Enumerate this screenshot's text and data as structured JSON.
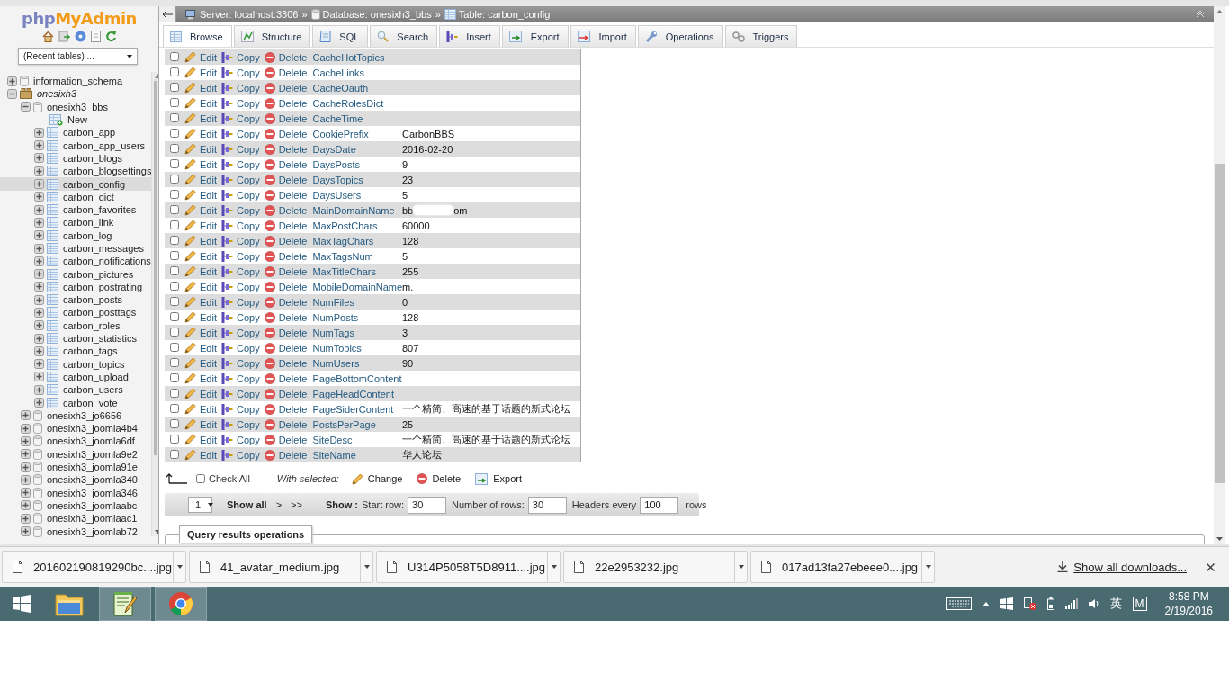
{
  "sidebar": {
    "logo_php": "php",
    "logo_name": "MyAdmin",
    "recent_tables": "(Recent tables) ...",
    "tree": [
      {
        "label": "information_schema",
        "kind": "database",
        "expanded": false
      },
      {
        "label": "onesixh3",
        "kind": "group",
        "expanded": true,
        "children": [
          {
            "label": "onesixh3_bbs",
            "kind": "database",
            "expanded": true,
            "children": [
              {
                "label": "New",
                "kind": "new"
              },
              {
                "label": "carbon_app",
                "kind": "table",
                "expanded": false,
                "selected": false
              },
              {
                "label": "carbon_app_users",
                "kind": "table",
                "expanded": false,
                "selected": false
              },
              {
                "label": "carbon_blogs",
                "kind": "table",
                "expanded": false,
                "selected": false
              },
              {
                "label": "carbon_blogsettings",
                "kind": "table",
                "expanded": false,
                "selected": false
              },
              {
                "label": "carbon_config",
                "kind": "table",
                "expanded": false,
                "selected": true
              },
              {
                "label": "carbon_dict",
                "kind": "table",
                "expanded": false,
                "selected": false
              },
              {
                "label": "carbon_favorites",
                "kind": "table",
                "expanded": false,
                "selected": false
              },
              {
                "label": "carbon_link",
                "kind": "table",
                "expanded": false,
                "selected": false
              },
              {
                "label": "carbon_log",
                "kind": "table",
                "expanded": false,
                "selected": false
              },
              {
                "label": "carbon_messages",
                "kind": "table",
                "expanded": false,
                "selected": false
              },
              {
                "label": "carbon_notifications",
                "kind": "table",
                "expanded": false,
                "selected": false
              },
              {
                "label": "carbon_pictures",
                "kind": "table",
                "expanded": false,
                "selected": false
              },
              {
                "label": "carbon_postrating",
                "kind": "table",
                "expanded": false,
                "selected": false
              },
              {
                "label": "carbon_posts",
                "kind": "table",
                "expanded": false,
                "selected": false
              },
              {
                "label": "carbon_posttags",
                "kind": "table",
                "expanded": false,
                "selected": false
              },
              {
                "label": "carbon_roles",
                "kind": "table",
                "expanded": false,
                "selected": false
              },
              {
                "label": "carbon_statistics",
                "kind": "table",
                "expanded": false,
                "selected": false
              },
              {
                "label": "carbon_tags",
                "kind": "table",
                "expanded": false,
                "selected": false
              },
              {
                "label": "carbon_topics",
                "kind": "table",
                "expanded": false,
                "selected": false
              },
              {
                "label": "carbon_upload",
                "kind": "table",
                "expanded": false,
                "selected": false
              },
              {
                "label": "carbon_users",
                "kind": "table",
                "expanded": false,
                "selected": false
              },
              {
                "label": "carbon_vote",
                "kind": "table",
                "expanded": false,
                "selected": false
              }
            ]
          },
          {
            "label": "onesixh3_jo6656",
            "kind": "database",
            "expanded": false
          },
          {
            "label": "onesixh3_joomla4b4",
            "kind": "database",
            "expanded": false
          },
          {
            "label": "onesixh3_joomla6df",
            "kind": "database",
            "expanded": false
          },
          {
            "label": "onesixh3_joomla9e2",
            "kind": "database",
            "expanded": false
          },
          {
            "label": "onesixh3_joomla91e",
            "kind": "database",
            "expanded": false
          },
          {
            "label": "onesixh3_joomla340",
            "kind": "database",
            "expanded": false
          },
          {
            "label": "onesixh3_joomla346",
            "kind": "database",
            "expanded": false
          },
          {
            "label": "onesixh3_joomlaabc",
            "kind": "database",
            "expanded": false
          },
          {
            "label": "onesixh3_joomlaac1",
            "kind": "database",
            "expanded": false
          },
          {
            "label": "onesixh3_joomlab72",
            "kind": "database",
            "expanded": false
          }
        ]
      }
    ]
  },
  "breadcrumb": {
    "separator": "»",
    "items": [
      {
        "kind": "server",
        "text": "Server: localhost:3306"
      },
      {
        "kind": "database",
        "text": "Database: onesixh3_bbs"
      },
      {
        "kind": "table",
        "text": "Table: carbon_config"
      }
    ]
  },
  "tabs": [
    {
      "label": "Browse",
      "selected": true
    },
    {
      "label": "Structure",
      "selected": false
    },
    {
      "label": "SQL",
      "selected": false
    },
    {
      "label": "Search",
      "selected": false
    },
    {
      "label": "Insert",
      "selected": false
    },
    {
      "label": "Export",
      "selected": false
    },
    {
      "label": "Import",
      "selected": false
    },
    {
      "label": "Operations",
      "selected": false
    },
    {
      "label": "Triggers",
      "selected": false
    }
  ],
  "rows": [
    {
      "checked": false,
      "actions": [
        "Edit",
        "Copy",
        "Delete"
      ],
      "name": "CacheHotTopics"
    },
    {
      "checked": false,
      "actions": [
        "Edit",
        "Copy",
        "Delete"
      ],
      "name": "CacheLinks"
    },
    {
      "checked": false,
      "actions": [
        "Edit",
        "Copy",
        "Delete"
      ],
      "name": "CacheOauth"
    },
    {
      "checked": false,
      "actions": [
        "Edit",
        "Copy",
        "Delete"
      ],
      "name": "CacheRolesDict"
    },
    {
      "checked": false,
      "actions": [
        "Edit",
        "Copy",
        "Delete"
      ],
      "name": "CacheTime"
    },
    {
      "checked": false,
      "actions": [
        "Edit",
        "Copy",
        "Delete"
      ],
      "name": "CookiePrefix",
      "value": "CarbonBBS_"
    },
    {
      "checked": false,
      "actions": [
        "Edit",
        "Copy",
        "Delete"
      ],
      "name": "DaysDate",
      "value": "2016-02-20"
    },
    {
      "checked": false,
      "actions": [
        "Edit",
        "Copy",
        "Delete"
      ],
      "name": "DaysPosts",
      "value": "9"
    },
    {
      "checked": false,
      "actions": [
        "Edit",
        "Copy",
        "Delete"
      ],
      "name": "DaysTopics",
      "value": "23"
    },
    {
      "checked": false,
      "actions": [
        "Edit",
        "Copy",
        "Delete"
      ],
      "name": "DaysUsers",
      "value": "5"
    },
    {
      "checked": false,
      "actions": [
        "Edit",
        "Copy",
        "Delete"
      ],
      "name": "MainDomainName",
      "value": "bb",
      "value_end": "om"
    },
    {
      "checked": false,
      "actions": [
        "Edit",
        "Copy",
        "Delete"
      ],
      "name": "MaxPostChars",
      "value": "60000"
    },
    {
      "checked": false,
      "actions": [
        "Edit",
        "Copy",
        "Delete"
      ],
      "name": "MaxTagChars",
      "value": "128"
    },
    {
      "checked": false,
      "actions": [
        "Edit",
        "Copy",
        "Delete"
      ],
      "name": "MaxTagsNum",
      "value": "5"
    },
    {
      "checked": false,
      "actions": [
        "Edit",
        "Copy",
        "Delete"
      ],
      "name": "MaxTitleChars",
      "value": "255"
    },
    {
      "checked": false,
      "actions": [
        "Edit",
        "Copy",
        "Delete"
      ],
      "name": "MobileDomainName",
      "value": "m."
    },
    {
      "checked": false,
      "actions": [
        "Edit",
        "Copy",
        "Delete"
      ],
      "name": "NumFiles",
      "value": "0"
    },
    {
      "checked": false,
      "actions": [
        "Edit",
        "Copy",
        "Delete"
      ],
      "name": "NumPosts",
      "value": "128"
    },
    {
      "checked": false,
      "actions": [
        "Edit",
        "Copy",
        "Delete"
      ],
      "name": "NumTags",
      "value": "3"
    },
    {
      "checked": false,
      "actions": [
        "Edit",
        "Copy",
        "Delete"
      ],
      "name": "NumTopics",
      "value": "807"
    },
    {
      "checked": false,
      "actions": [
        "Edit",
        "Copy",
        "Delete"
      ],
      "name": "NumUsers",
      "value": "90"
    },
    {
      "checked": false,
      "actions": [
        "Edit",
        "Copy",
        "Delete"
      ],
      "name": "PageBottomContent"
    },
    {
      "checked": false,
      "actions": [
        "Edit",
        "Copy",
        "Delete"
      ],
      "name": "PageHeadContent"
    },
    {
      "checked": false,
      "actions": [
        "Edit",
        "Copy",
        "Delete"
      ],
      "name": "PageSiderContent",
      "value": "一个精简、高速的基于话题的新式论坛"
    },
    {
      "checked": false,
      "actions": [
        "Edit",
        "Copy",
        "Delete"
      ],
      "name": "PostsPerPage",
      "value": "25"
    },
    {
      "checked": false,
      "actions": [
        "Edit",
        "Copy",
        "Delete"
      ],
      "name": "SiteDesc",
      "value": "一个精简、高速的基于话题的新式论坛"
    },
    {
      "checked": false,
      "actions": [
        "Edit",
        "Copy",
        "Delete"
      ],
      "name": "SiteName",
      "value": "华人论坛"
    }
  ],
  "bulk": {
    "check_all": "Check All",
    "check_all_checked": false,
    "with_selected": "With selected:",
    "actions": [
      {
        "kind": "change",
        "label": "Change"
      },
      {
        "kind": "delete",
        "label": "Delete"
      },
      {
        "kind": "export",
        "label": "Export"
      }
    ]
  },
  "navigation": {
    "page": "1",
    "show_all": "Show all",
    "next": ">",
    "last": ">>",
    "show_label": "Show :",
    "start_row_label": "Start row:",
    "start_row": "30",
    "rows_label": "Number of rows:",
    "rows": "30",
    "headers_label": "Headers every",
    "headers": "100",
    "rows_suffix": "rows"
  },
  "fieldset_legend": "Query results operations",
  "downloads": {
    "items": [
      {
        "name": "201602190819290bc....jpg"
      },
      {
        "name": "41_avatar_medium.jpg"
      },
      {
        "name": "U314P5058T5D8911....jpg"
      },
      {
        "name": "22e2953232.jpg"
      },
      {
        "name": "017ad13fa27ebeee0....jpg"
      }
    ],
    "show_all": "Show all downloads..."
  },
  "taskbar": {
    "apps": [
      {
        "kind": "folder",
        "active": false
      },
      {
        "kind": "editor",
        "active": true
      },
      {
        "kind": "browser",
        "active": true
      }
    ],
    "ime": "英",
    "ime_mode": "M",
    "time": "8:58 PM",
    "date": "2/19/2016"
  }
}
